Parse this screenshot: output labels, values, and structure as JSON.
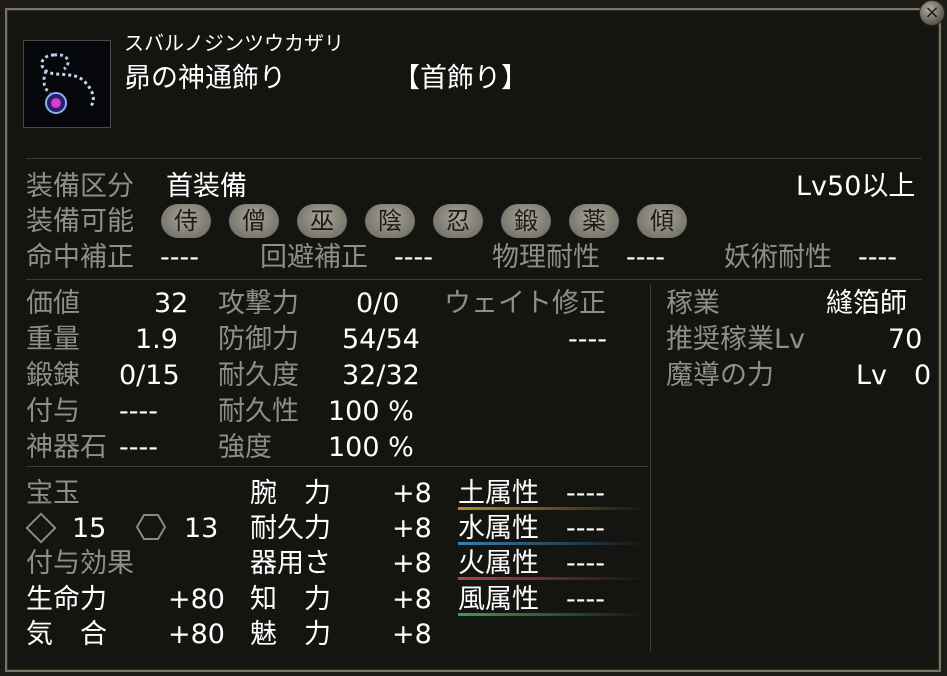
{
  "close_glyph": "×",
  "item": {
    "reading": "スバルノジンツウカザリ",
    "name": "昴の神通飾り",
    "category": "【首飾り】",
    "icon": "necklace-icon"
  },
  "equip": {
    "section_label": "装備区分",
    "section_value": "首装備",
    "level_req": "Lv50以上",
    "usable_label": "装備可能",
    "classes": [
      "侍",
      "僧",
      "巫",
      "陰",
      "忍",
      "鍛",
      "薬",
      "傾"
    ]
  },
  "corrections": [
    {
      "label": "命中補正",
      "value": "----"
    },
    {
      "label": "回避補正",
      "value": "----"
    },
    {
      "label": "物理耐性",
      "value": "----"
    },
    {
      "label": "妖術耐性",
      "value": "----"
    }
  ],
  "stats_left": [
    {
      "label": "価値",
      "value": "32"
    },
    {
      "label": "重量",
      "value": "1.9"
    },
    {
      "label": "鍛錬",
      "value": "0/15"
    },
    {
      "label": "付与",
      "value": "----"
    },
    {
      "label": "神器石",
      "value": "----"
    }
  ],
  "stats_mid": [
    {
      "label": "攻撃力",
      "value": "0/0"
    },
    {
      "label": "防御力",
      "value": "54/54"
    },
    {
      "label": "耐久度",
      "value": "32/32"
    },
    {
      "label": "耐久性",
      "value": "100 %"
    },
    {
      "label": "強度",
      "value": "100 %"
    }
  ],
  "weight_mod": {
    "label": "ウェイト修正",
    "value": "----"
  },
  "trade": [
    {
      "label": "稼業",
      "value": "縫箔師"
    },
    {
      "label": "推奨稼業Lv",
      "value": "70"
    },
    {
      "label": "魔導の力",
      "value": "Lv　0"
    }
  ],
  "gems": {
    "label": "宝玉",
    "slot1_value": "15",
    "slot2_value": "13"
  },
  "enchant_label": "付与効果",
  "enchants": [
    {
      "label": "生命力",
      "value": "+80"
    },
    {
      "label": "気　合",
      "value": "+80"
    }
  ],
  "attributes": [
    {
      "label": "腕　力",
      "value": "+8"
    },
    {
      "label": "耐久力",
      "value": "+8"
    },
    {
      "label": "器用さ",
      "value": "+8"
    },
    {
      "label": "知　力",
      "value": "+8"
    },
    {
      "label": "魅　力",
      "value": "+8"
    }
  ],
  "elements": [
    {
      "label": "土属性",
      "value": "----",
      "color": "#b58a2a"
    },
    {
      "label": "水属性",
      "value": "----",
      "color": "#3a7fb0"
    },
    {
      "label": "火属性",
      "value": "----",
      "color": "#b04050"
    },
    {
      "label": "風属性",
      "value": "----",
      "color": "#3f9a56"
    }
  ]
}
